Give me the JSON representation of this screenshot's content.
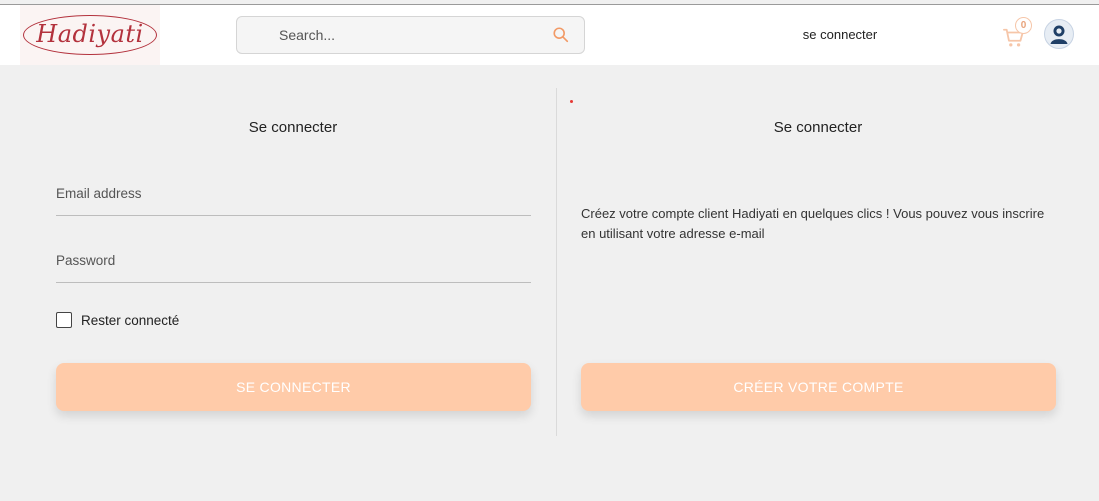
{
  "header": {
    "logo_text": "Hadiyati",
    "search": {
      "placeholder": "Search...",
      "value": ""
    },
    "login_link": "se connecter",
    "cart_count": "0"
  },
  "login_panel": {
    "title": "Se connecter",
    "email_placeholder": "Email address",
    "password_placeholder": "Password",
    "remember_label": "Rester connecté",
    "submit_label": "SE CONNECTER"
  },
  "register_panel": {
    "title": "Se connecter",
    "description": "Créez votre compte client Hadiyati en quelques clics ! Vous pouvez vous inscrire en utilisant votre adresse e-mail",
    "create_label": "CRÉER VOTRE COMPTE"
  },
  "colors": {
    "brand": "#b3323d",
    "button": "#ffcba9",
    "accent": "#f29a66",
    "background": "#f0f0f0"
  },
  "icons": [
    "search-icon",
    "cart-icon",
    "user-icon",
    "checkbox-icon"
  ]
}
